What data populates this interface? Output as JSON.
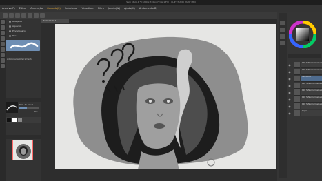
{
  "window": {
    "title": "Sem título-1 * (1280 x 720px 72dpi 13%) - CLIP STUDIO PAINT PRO"
  },
  "menubar": {
    "items": [
      "Arquivo(F)",
      "Editar",
      "Animação",
      "Camada(L)",
      "Selecionar",
      "Visualizar",
      "Filtro",
      "Janela(W)",
      "Ajuda(H)",
      "Andamento(B)"
    ],
    "active_index": 3
  },
  "canvas": {
    "tab_label": "Sem título-1"
  },
  "subtools": {
    "items": [
      "Apagador",
      "Aquarela",
      "Pincel opaco",
      "Pena",
      "Lápis",
      "Marcador"
    ]
  },
  "left_panel": {
    "add_brush_label": "Adicionar subferramenta",
    "brush_size_label": "Tam. do pincel",
    "brush_size_value": "6.0"
  },
  "layers": [
    {
      "name": "100 % Normal Camada 8",
      "selected": false
    },
    {
      "name": "100 % Normal Camada 6",
      "selected": false
    },
    {
      "name": "Camada 5",
      "selected": true
    },
    {
      "name": "100 % Normal Camada 4",
      "selected": false
    },
    {
      "name": "100 % Normal Camada 3",
      "selected": false
    },
    {
      "name": "100 % Normal Camada 2",
      "selected": false
    },
    {
      "name": "100 % Normal Camada 1",
      "selected": false
    },
    {
      "name": "Papel",
      "selected": false
    }
  ],
  "colors": {
    "accent": "#f0b43c",
    "layer_selected": "#4f6c8f",
    "paper": "#e6e6e4"
  }
}
